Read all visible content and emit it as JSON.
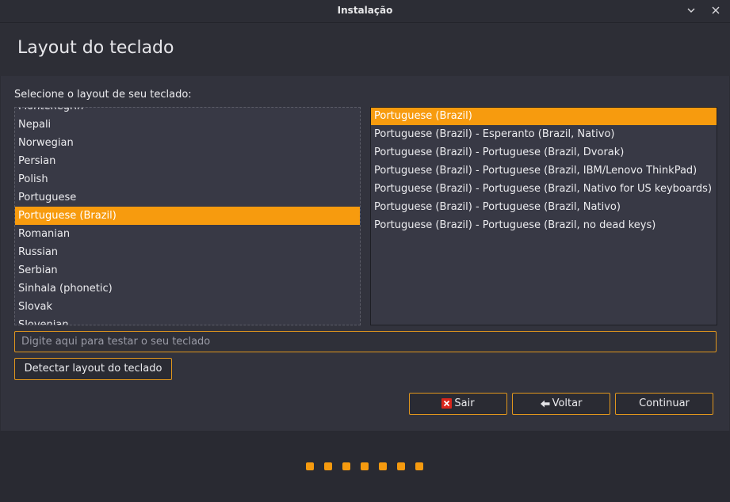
{
  "window": {
    "title": "Instalação"
  },
  "header": {
    "title": "Layout do teclado"
  },
  "main": {
    "prompt": "Selecione o layout de seu teclado:",
    "layouts": [
      {
        "label": "Montenegrin",
        "selected": false
      },
      {
        "label": "Nepali",
        "selected": false
      },
      {
        "label": "Norwegian",
        "selected": false
      },
      {
        "label": "Persian",
        "selected": false
      },
      {
        "label": "Polish",
        "selected": false
      },
      {
        "label": "Portuguese",
        "selected": false
      },
      {
        "label": "Portuguese (Brazil)",
        "selected": true
      },
      {
        "label": "Romanian",
        "selected": false
      },
      {
        "label": "Russian",
        "selected": false
      },
      {
        "label": "Serbian",
        "selected": false
      },
      {
        "label": "Sinhala (phonetic)",
        "selected": false
      },
      {
        "label": "Slovak",
        "selected": false
      },
      {
        "label": "Slovenian",
        "selected": false
      }
    ],
    "variants": [
      {
        "label": "Portuguese (Brazil)",
        "selected": true
      },
      {
        "label": "Portuguese (Brazil) - Esperanto (Brazil, Nativo)",
        "selected": false
      },
      {
        "label": "Portuguese (Brazil) - Portuguese (Brazil, Dvorak)",
        "selected": false
      },
      {
        "label": "Portuguese (Brazil) - Portuguese (Brazil, IBM/Lenovo ThinkPad)",
        "selected": false
      },
      {
        "label": "Portuguese (Brazil) - Portuguese (Brazil, Nativo for US keyboards)",
        "selected": false
      },
      {
        "label": "Portuguese (Brazil) - Portuguese (Brazil, Nativo)",
        "selected": false
      },
      {
        "label": "Portuguese (Brazil) - Portuguese (Brazil, no dead keys)",
        "selected": false
      }
    ],
    "test_input": {
      "placeholder": "Digite aqui para testar o seu teclado",
      "value": ""
    },
    "detect_button": "Detectar layout do teclado"
  },
  "buttons": {
    "quit": {
      "label": "Sair",
      "icon": "close-red-icon"
    },
    "back": {
      "label": "Voltar",
      "icon": "arrow-left-icon"
    },
    "continue": {
      "label": "Continuar"
    }
  },
  "progress": {
    "total_steps": 7,
    "color": "#f59a0f"
  },
  "colors": {
    "accent": "#f79b0e",
    "background": "#2b2c34",
    "panel": "#32333d",
    "list_background": "#383945"
  }
}
